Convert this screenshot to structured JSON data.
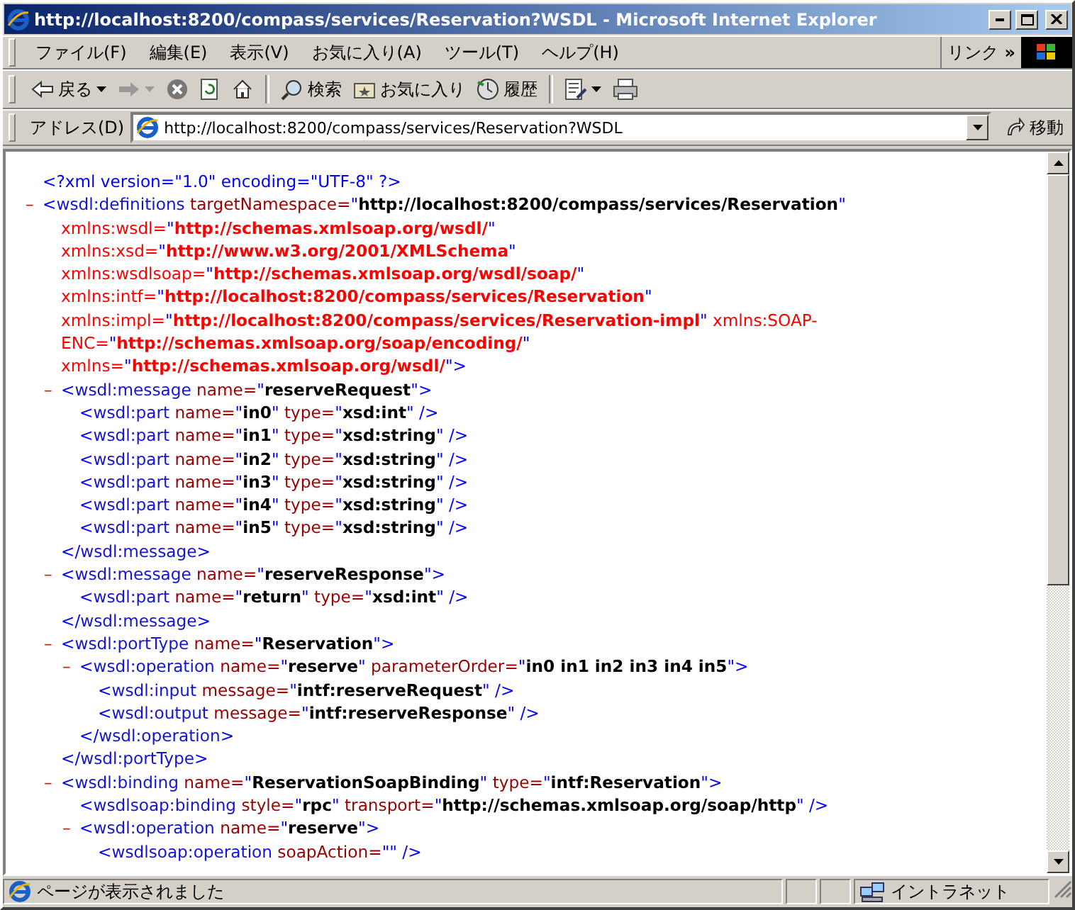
{
  "window": {
    "title": "http://localhost:8200/compass/services/Reservation?WSDL - Microsoft Internet Explorer"
  },
  "menu": [
    "ファイル(F)",
    "編集(E)",
    "表示(V)",
    "お気に入り(A)",
    "ツール(T)",
    "ヘルプ(H)"
  ],
  "links": {
    "label": "リンク",
    "chevron": "»"
  },
  "toolbar": [
    {
      "kind": "back",
      "label": "戻る",
      "disabled": false,
      "dropdown": true
    },
    {
      "kind": "forward",
      "disabled": true,
      "dropdown": true
    },
    {
      "kind": "stop",
      "disabled": false,
      "dropdown": false
    },
    {
      "kind": "refresh",
      "disabled": false,
      "dropdown": false
    },
    {
      "kind": "home",
      "disabled": false,
      "dropdown": false
    },
    {
      "kind": "search",
      "label": "検索",
      "disabled": false,
      "dropdown": false
    },
    {
      "kind": "favorites",
      "label": "お気に入り",
      "disabled": false,
      "dropdown": false
    },
    {
      "kind": "history",
      "label": "履歴",
      "disabled": false,
      "dropdown": false
    },
    {
      "kind": "edit",
      "disabled": false,
      "dropdown": true
    },
    {
      "kind": "print",
      "disabled": false,
      "dropdown": false
    }
  ],
  "address": {
    "label": "アドレス(D)",
    "value": "http://localhost:8200/compass/services/Reservation?WSDL",
    "go": "移動"
  },
  "document": [
    {
      "open": [
        [
          {
            "kind": "p",
            "text": "<?xml version=\"1.0\" encoding=\"UTF-8\" ?>"
          }
        ]
      ]
    },
    {
      "toggle": "–",
      "open": [
        [
          {
            "kind": "p",
            "text": "<"
          },
          {
            "kind": "tag",
            "text": "wsdl:definitions"
          },
          {
            "kind": "attr",
            "text": " targetNamespace="
          },
          {
            "kind": "p",
            "text": "\""
          },
          {
            "kind": "val",
            "text": "http://localhost:8200/compass/services/Reservation"
          },
          {
            "kind": "p",
            "text": "\""
          }
        ],
        [
          {
            "kind": "nsattr",
            "text": "xmlns:wsdl="
          },
          {
            "kind": "p",
            "text": "\""
          },
          {
            "kind": "nsval",
            "text": "http://schemas.xmlsoap.org/wsdl/"
          },
          {
            "kind": "p",
            "text": "\""
          }
        ],
        [
          {
            "kind": "nsattr",
            "text": "xmlns:xsd="
          },
          {
            "kind": "p",
            "text": "\""
          },
          {
            "kind": "nsval",
            "text": "http://www.w3.org/2001/XMLSchema"
          },
          {
            "kind": "p",
            "text": "\""
          }
        ],
        [
          {
            "kind": "nsattr",
            "text": "xmlns:wsdlsoap="
          },
          {
            "kind": "p",
            "text": "\""
          },
          {
            "kind": "nsval",
            "text": "http://schemas.xmlsoap.org/wsdl/soap/"
          },
          {
            "kind": "p",
            "text": "\""
          }
        ],
        [
          {
            "kind": "nsattr",
            "text": "xmlns:intf="
          },
          {
            "kind": "p",
            "text": "\""
          },
          {
            "kind": "nsval",
            "text": "http://localhost:8200/compass/services/Reservation"
          },
          {
            "kind": "p",
            "text": "\""
          }
        ],
        [
          {
            "kind": "nsattr",
            "text": "xmlns:impl="
          },
          {
            "kind": "p",
            "text": "\""
          },
          {
            "kind": "nsval",
            "text": "http://localhost:8200/compass/services/Reservation-impl"
          },
          {
            "kind": "p",
            "text": "\""
          },
          {
            "kind": "nsattr",
            "text": " xmlns:SOAP-"
          }
        ],
        [
          {
            "kind": "nsattr",
            "text": "ENC="
          },
          {
            "kind": "p",
            "text": "\""
          },
          {
            "kind": "nsval",
            "text": "http://schemas.xmlsoap.org/soap/encoding/"
          },
          {
            "kind": "p",
            "text": "\""
          }
        ],
        [
          {
            "kind": "nsattr",
            "text": "xmlns="
          },
          {
            "kind": "p",
            "text": "\""
          },
          {
            "kind": "nsval",
            "text": "http://schemas.xmlsoap.org/wsdl/"
          },
          {
            "kind": "p",
            "text": "\">"
          }
        ]
      ],
      "children": [
        {
          "toggle": "–",
          "open": [
            [
              {
                "kind": "p",
                "text": "<"
              },
              {
                "kind": "tag",
                "text": "wsdl:message"
              },
              {
                "kind": "attr",
                "text": " name="
              },
              {
                "kind": "p",
                "text": "\""
              },
              {
                "kind": "val",
                "text": "reserveRequest"
              },
              {
                "kind": "p",
                "text": "\">"
              }
            ]
          ],
          "children": [
            {
              "open": [
                [
                  {
                    "kind": "p",
                    "text": "<"
                  },
                  {
                    "kind": "tag",
                    "text": "wsdl:part"
                  },
                  {
                    "kind": "attr",
                    "text": " name="
                  },
                  {
                    "kind": "p",
                    "text": "\""
                  },
                  {
                    "kind": "val",
                    "text": "in0"
                  },
                  {
                    "kind": "p",
                    "text": "\""
                  },
                  {
                    "kind": "attr",
                    "text": " type="
                  },
                  {
                    "kind": "p",
                    "text": "\""
                  },
                  {
                    "kind": "val",
                    "text": "xsd:int"
                  },
                  {
                    "kind": "p",
                    "text": "\" />"
                  }
                ]
              ]
            },
            {
              "open": [
                [
                  {
                    "kind": "p",
                    "text": "<"
                  },
                  {
                    "kind": "tag",
                    "text": "wsdl:part"
                  },
                  {
                    "kind": "attr",
                    "text": " name="
                  },
                  {
                    "kind": "p",
                    "text": "\""
                  },
                  {
                    "kind": "val",
                    "text": "in1"
                  },
                  {
                    "kind": "p",
                    "text": "\""
                  },
                  {
                    "kind": "attr",
                    "text": " type="
                  },
                  {
                    "kind": "p",
                    "text": "\""
                  },
                  {
                    "kind": "val",
                    "text": "xsd:string"
                  },
                  {
                    "kind": "p",
                    "text": "\" />"
                  }
                ]
              ]
            },
            {
              "open": [
                [
                  {
                    "kind": "p",
                    "text": "<"
                  },
                  {
                    "kind": "tag",
                    "text": "wsdl:part"
                  },
                  {
                    "kind": "attr",
                    "text": " name="
                  },
                  {
                    "kind": "p",
                    "text": "\""
                  },
                  {
                    "kind": "val",
                    "text": "in2"
                  },
                  {
                    "kind": "p",
                    "text": "\""
                  },
                  {
                    "kind": "attr",
                    "text": " type="
                  },
                  {
                    "kind": "p",
                    "text": "\""
                  },
                  {
                    "kind": "val",
                    "text": "xsd:string"
                  },
                  {
                    "kind": "p",
                    "text": "\" />"
                  }
                ]
              ]
            },
            {
              "open": [
                [
                  {
                    "kind": "p",
                    "text": "<"
                  },
                  {
                    "kind": "tag",
                    "text": "wsdl:part"
                  },
                  {
                    "kind": "attr",
                    "text": " name="
                  },
                  {
                    "kind": "p",
                    "text": "\""
                  },
                  {
                    "kind": "val",
                    "text": "in3"
                  },
                  {
                    "kind": "p",
                    "text": "\""
                  },
                  {
                    "kind": "attr",
                    "text": " type="
                  },
                  {
                    "kind": "p",
                    "text": "\""
                  },
                  {
                    "kind": "val",
                    "text": "xsd:string"
                  },
                  {
                    "kind": "p",
                    "text": "\" />"
                  }
                ]
              ]
            },
            {
              "open": [
                [
                  {
                    "kind": "p",
                    "text": "<"
                  },
                  {
                    "kind": "tag",
                    "text": "wsdl:part"
                  },
                  {
                    "kind": "attr",
                    "text": " name="
                  },
                  {
                    "kind": "p",
                    "text": "\""
                  },
                  {
                    "kind": "val",
                    "text": "in4"
                  },
                  {
                    "kind": "p",
                    "text": "\""
                  },
                  {
                    "kind": "attr",
                    "text": " type="
                  },
                  {
                    "kind": "p",
                    "text": "\""
                  },
                  {
                    "kind": "val",
                    "text": "xsd:string"
                  },
                  {
                    "kind": "p",
                    "text": "\" />"
                  }
                ]
              ]
            },
            {
              "open": [
                [
                  {
                    "kind": "p",
                    "text": "<"
                  },
                  {
                    "kind": "tag",
                    "text": "wsdl:part"
                  },
                  {
                    "kind": "attr",
                    "text": " name="
                  },
                  {
                    "kind": "p",
                    "text": "\""
                  },
                  {
                    "kind": "val",
                    "text": "in5"
                  },
                  {
                    "kind": "p",
                    "text": "\""
                  },
                  {
                    "kind": "attr",
                    "text": " type="
                  },
                  {
                    "kind": "p",
                    "text": "\""
                  },
                  {
                    "kind": "val",
                    "text": "xsd:string"
                  },
                  {
                    "kind": "p",
                    "text": "\" />"
                  }
                ]
              ]
            }
          ],
          "close": [
            {
              "kind": "p",
              "text": "</"
            },
            {
              "kind": "tag",
              "text": "wsdl:message"
            },
            {
              "kind": "p",
              "text": ">"
            }
          ]
        },
        {
          "toggle": "–",
          "open": [
            [
              {
                "kind": "p",
                "text": "<"
              },
              {
                "kind": "tag",
                "text": "wsdl:message"
              },
              {
                "kind": "attr",
                "text": " name="
              },
              {
                "kind": "p",
                "text": "\""
              },
              {
                "kind": "val",
                "text": "reserveResponse"
              },
              {
                "kind": "p",
                "text": "\">"
              }
            ]
          ],
          "children": [
            {
              "open": [
                [
                  {
                    "kind": "p",
                    "text": "<"
                  },
                  {
                    "kind": "tag",
                    "text": "wsdl:part"
                  },
                  {
                    "kind": "attr",
                    "text": " name="
                  },
                  {
                    "kind": "p",
                    "text": "\""
                  },
                  {
                    "kind": "val",
                    "text": "return"
                  },
                  {
                    "kind": "p",
                    "text": "\""
                  },
                  {
                    "kind": "attr",
                    "text": " type="
                  },
                  {
                    "kind": "p",
                    "text": "\""
                  },
                  {
                    "kind": "val",
                    "text": "xsd:int"
                  },
                  {
                    "kind": "p",
                    "text": "\" />"
                  }
                ]
              ]
            }
          ],
          "close": [
            {
              "kind": "p",
              "text": "</"
            },
            {
              "kind": "tag",
              "text": "wsdl:message"
            },
            {
              "kind": "p",
              "text": ">"
            }
          ]
        },
        {
          "toggle": "–",
          "open": [
            [
              {
                "kind": "p",
                "text": "<"
              },
              {
                "kind": "tag",
                "text": "wsdl:portType"
              },
              {
                "kind": "attr",
                "text": " name="
              },
              {
                "kind": "p",
                "text": "\""
              },
              {
                "kind": "val",
                "text": "Reservation"
              },
              {
                "kind": "p",
                "text": "\">"
              }
            ]
          ],
          "children": [
            {
              "toggle": "–",
              "open": [
                [
                  {
                    "kind": "p",
                    "text": "<"
                  },
                  {
                    "kind": "tag",
                    "text": "wsdl:operation"
                  },
                  {
                    "kind": "attr",
                    "text": " name="
                  },
                  {
                    "kind": "p",
                    "text": "\""
                  },
                  {
                    "kind": "val",
                    "text": "reserve"
                  },
                  {
                    "kind": "p",
                    "text": "\""
                  },
                  {
                    "kind": "attr",
                    "text": " parameterOrder="
                  },
                  {
                    "kind": "p",
                    "text": "\""
                  },
                  {
                    "kind": "val",
                    "text": "in0 in1 in2 in3 in4 in5"
                  },
                  {
                    "kind": "p",
                    "text": "\">"
                  }
                ]
              ],
              "children": [
                {
                  "open": [
                    [
                      {
                        "kind": "p",
                        "text": "<"
                      },
                      {
                        "kind": "tag",
                        "text": "wsdl:input"
                      },
                      {
                        "kind": "attr",
                        "text": " message="
                      },
                      {
                        "kind": "p",
                        "text": "\""
                      },
                      {
                        "kind": "val",
                        "text": "intf:reserveRequest"
                      },
                      {
                        "kind": "p",
                        "text": "\" />"
                      }
                    ]
                  ]
                },
                {
                  "open": [
                    [
                      {
                        "kind": "p",
                        "text": "<"
                      },
                      {
                        "kind": "tag",
                        "text": "wsdl:output"
                      },
                      {
                        "kind": "attr",
                        "text": " message="
                      },
                      {
                        "kind": "p",
                        "text": "\""
                      },
                      {
                        "kind": "val",
                        "text": "intf:reserveResponse"
                      },
                      {
                        "kind": "p",
                        "text": "\" />"
                      }
                    ]
                  ]
                }
              ],
              "close": [
                {
                  "kind": "p",
                  "text": "</"
                },
                {
                  "kind": "tag",
                  "text": "wsdl:operation"
                },
                {
                  "kind": "p",
                  "text": ">"
                }
              ]
            }
          ],
          "close": [
            {
              "kind": "p",
              "text": "</"
            },
            {
              "kind": "tag",
              "text": "wsdl:portType"
            },
            {
              "kind": "p",
              "text": ">"
            }
          ]
        },
        {
          "toggle": "–",
          "open": [
            [
              {
                "kind": "p",
                "text": "<"
              },
              {
                "kind": "tag",
                "text": "wsdl:binding"
              },
              {
                "kind": "attr",
                "text": " name="
              },
              {
                "kind": "p",
                "text": "\""
              },
              {
                "kind": "val",
                "text": "ReservationSoapBinding"
              },
              {
                "kind": "p",
                "text": "\""
              },
              {
                "kind": "attr",
                "text": " type="
              },
              {
                "kind": "p",
                "text": "\""
              },
              {
                "kind": "val",
                "text": "intf:Reservation"
              },
              {
                "kind": "p",
                "text": "\">"
              }
            ]
          ],
          "children": [
            {
              "open": [
                [
                  {
                    "kind": "p",
                    "text": "<"
                  },
                  {
                    "kind": "tag",
                    "text": "wsdlsoap:binding"
                  },
                  {
                    "kind": "attr",
                    "text": " style="
                  },
                  {
                    "kind": "p",
                    "text": "\""
                  },
                  {
                    "kind": "val",
                    "text": "rpc"
                  },
                  {
                    "kind": "p",
                    "text": "\""
                  },
                  {
                    "kind": "attr",
                    "text": " transport="
                  },
                  {
                    "kind": "p",
                    "text": "\""
                  },
                  {
                    "kind": "val",
                    "text": "http://schemas.xmlsoap.org/soap/http"
                  },
                  {
                    "kind": "p",
                    "text": "\" />"
                  }
                ]
              ]
            },
            {
              "toggle": "–",
              "open": [
                [
                  {
                    "kind": "p",
                    "text": "<"
                  },
                  {
                    "kind": "tag",
                    "text": "wsdl:operation"
                  },
                  {
                    "kind": "attr",
                    "text": " name="
                  },
                  {
                    "kind": "p",
                    "text": "\""
                  },
                  {
                    "kind": "val",
                    "text": "reserve"
                  },
                  {
                    "kind": "p",
                    "text": "\">"
                  }
                ]
              ],
              "children": [
                {
                  "open": [
                    [
                      {
                        "kind": "p",
                        "text": "<"
                      },
                      {
                        "kind": "tag",
                        "text": "wsdlsoap:operation"
                      },
                      {
                        "kind": "attr",
                        "text": " soapAction="
                      },
                      {
                        "kind": "p",
                        "text": "\"\" />"
                      }
                    ]
                  ]
                }
              ]
            }
          ]
        }
      ]
    }
  ],
  "status_bar": {
    "text": "ページが表示されました",
    "zone": "イントラネット"
  }
}
